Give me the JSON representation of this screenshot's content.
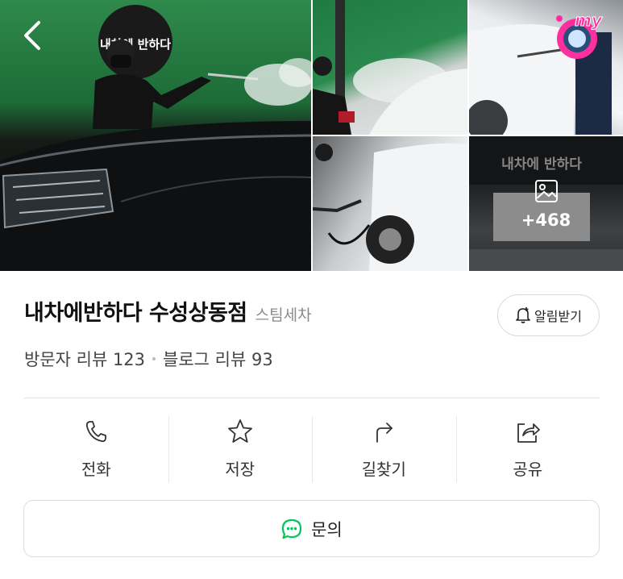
{
  "gallery": {
    "main_sign_text": "내차에 반하다",
    "shop_sign_text": "내차에 반하다",
    "more_count": "+468",
    "badge_text": "my"
  },
  "place": {
    "name": "내차에반하다 수성상동점",
    "category": "스팀세차",
    "visitor_reviews": "방문자 리뷰 123",
    "blog_reviews": "블로그 리뷰 93"
  },
  "alarm": {
    "label": "알림받기"
  },
  "actions": [
    {
      "label": "전화",
      "icon": "phone-icon"
    },
    {
      "label": "저장",
      "icon": "star-icon"
    },
    {
      "label": "길찾기",
      "icon": "directions-icon"
    },
    {
      "label": "공유",
      "icon": "share-icon"
    }
  ],
  "inquiry": {
    "label": "문의"
  },
  "colors": {
    "accent_green": "#03c75a",
    "text_primary": "#111111",
    "text_secondary": "#8a8a8a",
    "border": "#dcdcdc"
  }
}
